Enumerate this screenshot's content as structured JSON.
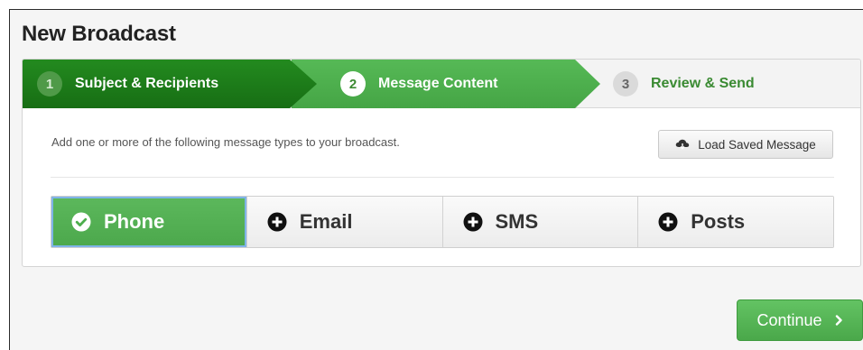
{
  "page": {
    "title": "New Broadcast"
  },
  "wizard": {
    "steps": [
      {
        "number": "1",
        "label": "Subject & Recipients",
        "state": "completed"
      },
      {
        "number": "2",
        "label": "Message Content",
        "state": "current"
      },
      {
        "number": "3",
        "label": "Review & Send",
        "state": "upcoming"
      }
    ]
  },
  "content": {
    "instructions": "Add one or more of the following message types to your broadcast.",
    "load_button": {
      "label": "Load Saved Message",
      "icon": "cloud-download-icon"
    }
  },
  "message_types": [
    {
      "label": "Phone",
      "icon": "check-circle-icon",
      "selected": true
    },
    {
      "label": "Email",
      "icon": "plus-circle-icon",
      "selected": false
    },
    {
      "label": "SMS",
      "icon": "plus-circle-icon",
      "selected": false
    },
    {
      "label": "Posts",
      "icon": "plus-circle-icon",
      "selected": false
    }
  ],
  "footer": {
    "continue_label": "Continue",
    "continue_icon": "chevron-right-icon"
  },
  "colors": {
    "completed_step": "#1f7a1a",
    "current_step": "#4cae4c",
    "accent_green": "#5cb85c",
    "upcoming_text": "#3a8a32"
  }
}
